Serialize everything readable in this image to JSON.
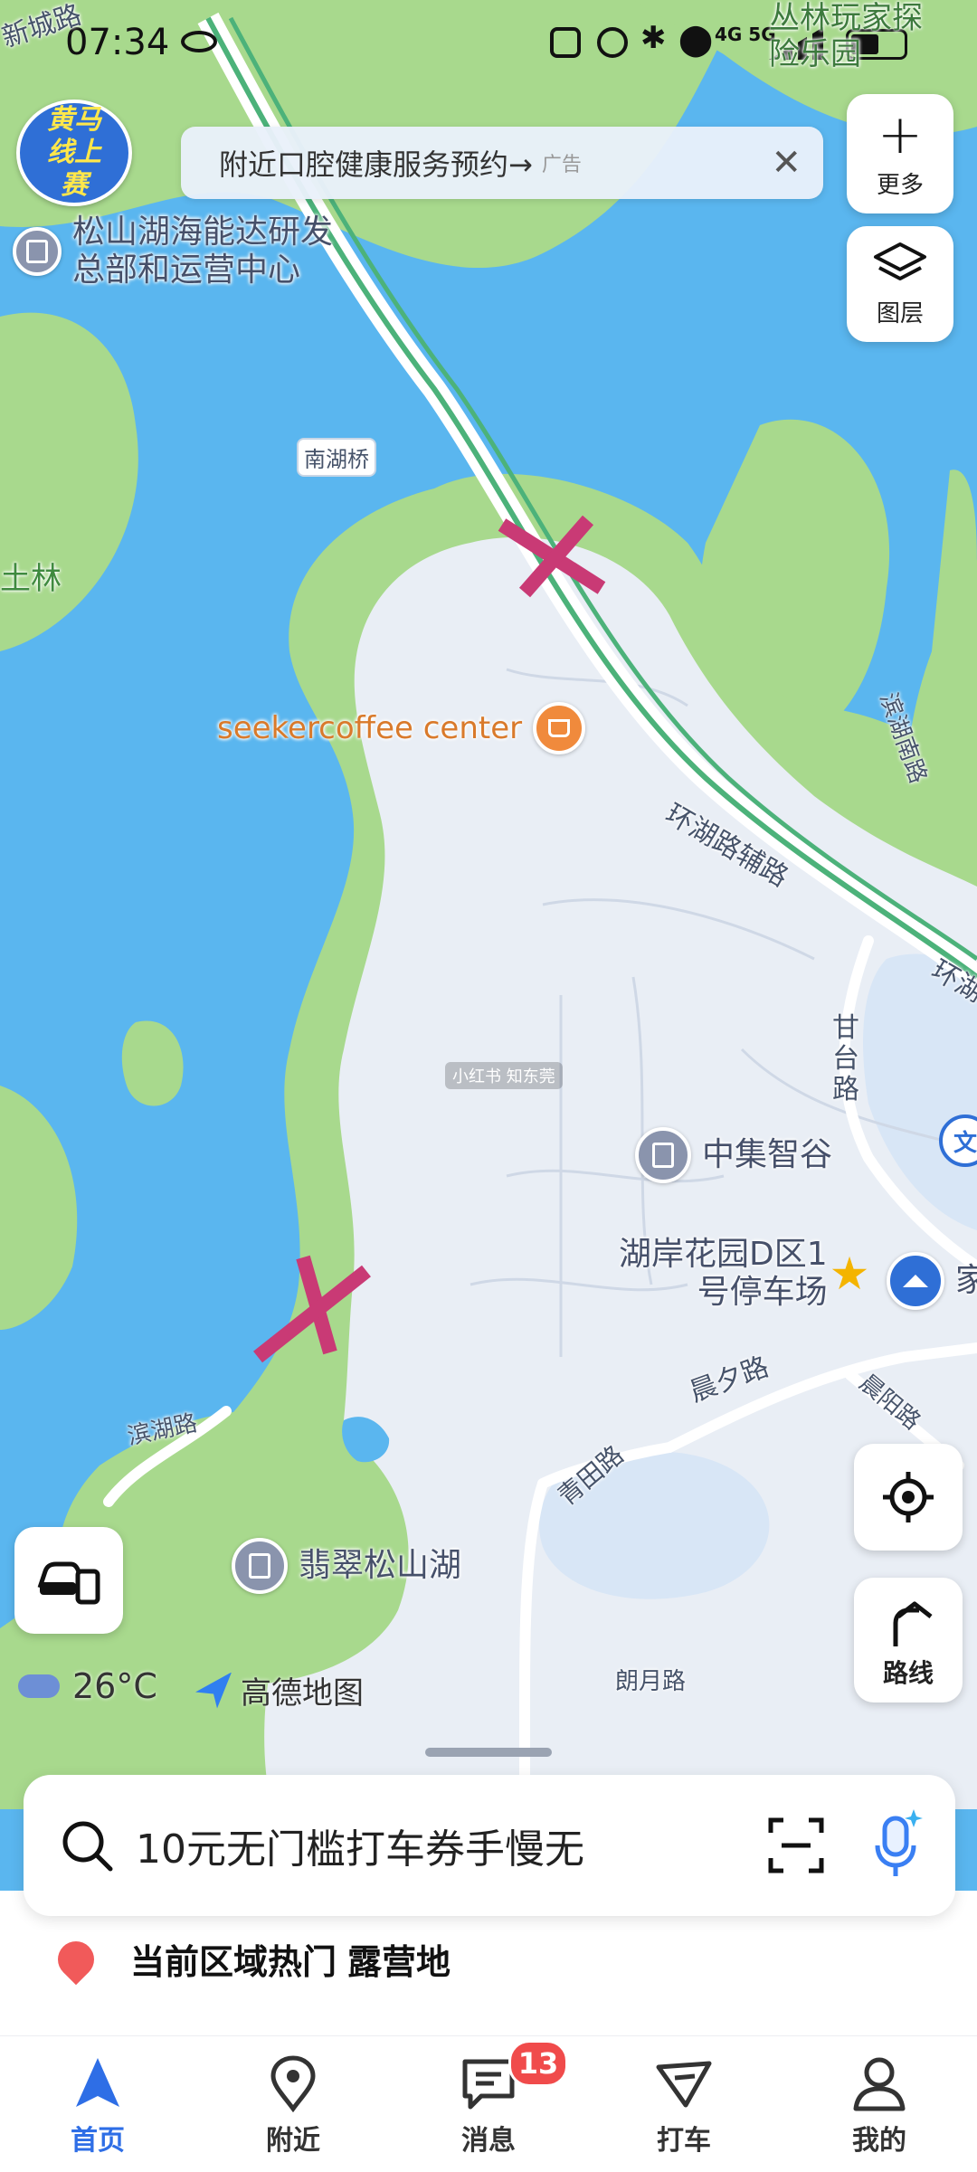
{
  "status_bar": {
    "time": "07:34",
    "carrier_text": "4G 5G"
  },
  "map": {
    "top_right_text": "丛林玩家探险乐园",
    "top_left_road": "新城路",
    "corner_badge": "黄马线上赛",
    "labels": {
      "nanhu_bridge": "南湖桥",
      "tulin": "土林",
      "huanhu_aux": "环湖路辅路",
      "binhu_south": "滨湖南路",
      "huanhu": "环湖",
      "gantai": "甘台路",
      "chenxi": "晨夕路",
      "chenyang": "晨阳路",
      "qingtian": "青田路",
      "binhu": "滨湖路",
      "langyue": "朗月路",
      "wen": "文"
    },
    "pois": {
      "songshan_hainengda": "松山湖海能达研发\n总部和运营中心",
      "seeker": "seekercoffee center",
      "zhongji": "中集智谷",
      "huan_parking": "湖岸花园D区1\n号停车场",
      "home": "家",
      "feicui": "翡翠松山湖"
    },
    "watermark": "小红书 知东莞",
    "weather": {
      "temp": "26°C"
    },
    "attribution": "高德地图"
  },
  "banner": {
    "text": "附近口腔健康服务预约→",
    "ad_tag": "广告"
  },
  "controls": {
    "more_label": "更多",
    "layers_label": "图层",
    "route_label": "路线"
  },
  "search": {
    "text": "10元无门槛打车券手慢无"
  },
  "hot": {
    "prefix": "当前区域热门",
    "keyword": "露营地"
  },
  "tabs": [
    {
      "label": "首页",
      "icon": "home-icon"
    },
    {
      "label": "附近",
      "icon": "location-pin-icon"
    },
    {
      "label": "消息",
      "icon": "message-icon",
      "badge": "13"
    },
    {
      "label": "打车",
      "icon": "taxi-icon"
    },
    {
      "label": "我的",
      "icon": "profile-icon"
    }
  ],
  "colors": {
    "water": "#5ab6ef",
    "land": "#e9eef5",
    "green": "#a8d98d",
    "road_green": "#4cb27a",
    "accent": "#2e6ee6",
    "badge": "#f04b4b",
    "marker": "#c93a75"
  }
}
